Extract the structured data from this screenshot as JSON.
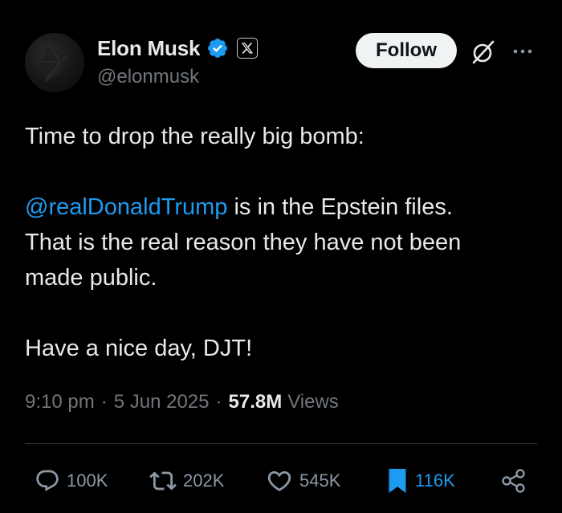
{
  "author": {
    "display_name": "Elon Musk",
    "handle": "@elonmusk",
    "verified": true,
    "affiliate_badge_label": "X"
  },
  "header": {
    "follow_label": "Follow"
  },
  "tweet": {
    "line1": "Time to drop the really big bomb:",
    "mention": "@realDonaldTrump",
    "line2_rest": " is in the Epstein files.",
    "line3": "That is the real reason they have not been",
    "line4": "made public.",
    "line5": "Have a nice day, DJT!"
  },
  "meta": {
    "time": "9:10 pm",
    "date": "5 Jun 2025",
    "views_count": "57.8M",
    "views_label": "Views"
  },
  "actions": {
    "replies": "100K",
    "reposts": "202K",
    "likes": "545K",
    "bookmarks": "116K"
  },
  "colors": {
    "background": "#000000",
    "text": "#e7e9ea",
    "secondary": "#71767b",
    "accent": "#1d9bf0",
    "verified": "#1d9bf0"
  },
  "icons": [
    "verified-badge-icon",
    "x-logo-icon",
    "grok-icon",
    "more-icon",
    "reply-icon",
    "repost-icon",
    "like-icon",
    "bookmark-icon",
    "share-icon"
  ]
}
